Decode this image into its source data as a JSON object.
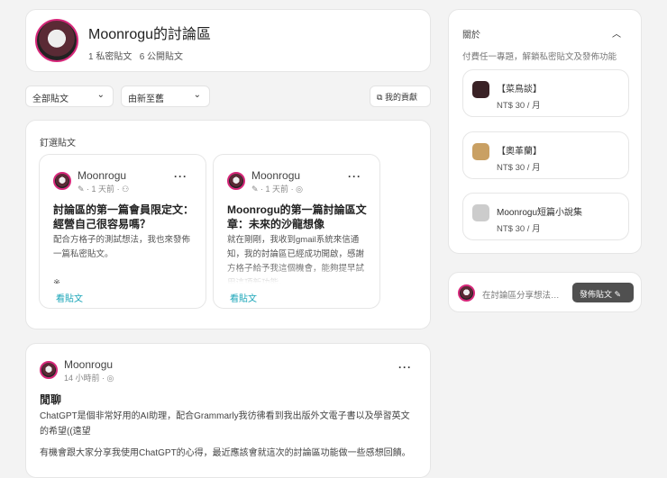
{
  "header": {
    "title": "Moonrogu的討論區",
    "private_count": "1",
    "private_label": "私密貼文",
    "public_count": "6",
    "public_label": "公開貼文"
  },
  "filters": {
    "type": "全部貼文",
    "sort": "由新至舊",
    "contributions": "我的貢獻"
  },
  "pinned": {
    "heading": "釘選貼文",
    "posts": [
      {
        "author": "Moonrogu",
        "time": "1 天前",
        "title": "討論區的第一篇會員限定文：經營自己很容易嗎？",
        "body": "配合方格子的測試想法，我也來發佈一篇私密貼文。\n\n※",
        "link": "看貼文"
      },
      {
        "author": "Moonrogu",
        "time": "1 天前",
        "title": "Moonrogu的第一篇討論區文章：未來的沙龍想像",
        "body": "就在剛剛，我收到gmail系統來信通知，我的討論區已經成功開啟，感謝方格子給予我這個機會，能夠提早試用這項新功能。",
        "link": "看貼文"
      }
    ]
  },
  "post": {
    "author": "Moonrogu",
    "time": "14 小時前",
    "title": "閒聊",
    "para1": "ChatGPT是個非常好用的AI助理，配合Grammarly我彷彿看到我出版外文電子書以及學習英文的希望((遠望",
    "para2": "有機會跟大家分享我使用ChatGPT的心得，最近應該會就這次的討論區功能做一些感想回饋。"
  },
  "about": {
    "heading": "關於",
    "desc": "付費任一專題，解鎖私密貼文及發佈功能",
    "plans": [
      {
        "name": "【菜鳥談】",
        "price": "NT$ 30 / 月",
        "color": "#3a2226"
      },
      {
        "name": "【奧革蘭】",
        "price": "NT$ 30 / 月",
        "color": "#c9a063"
      },
      {
        "name": "Moonrogu短篇小說集",
        "price": "NT$ 30 / 月",
        "color": "#bbbbbb"
      }
    ]
  },
  "compose": {
    "placeholder": "在討論區分享想法…",
    "button": "發佈貼文"
  }
}
